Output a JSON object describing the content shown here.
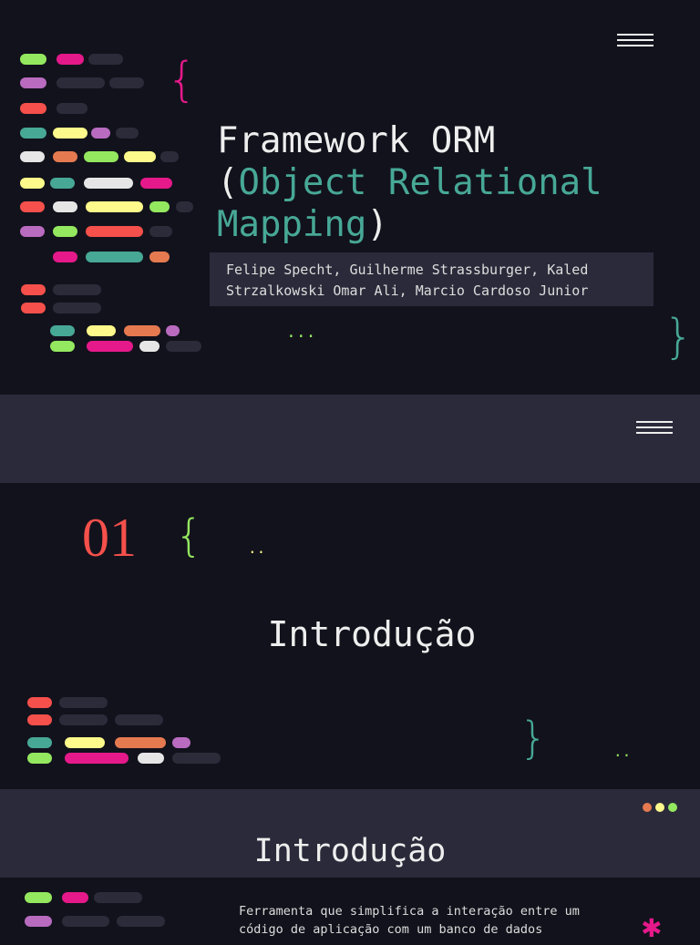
{
  "colors": {
    "bg": "#12121c",
    "panel": "#2b2a3a",
    "green": "#94e85f",
    "pink": "#e5198a",
    "purple": "#b86bbf",
    "red": "#f5504b",
    "teal": "#47a896",
    "yellow": "#fdf98b",
    "white": "#e6e6e6",
    "orange": "#e57a50",
    "dark": "#2c2b3a"
  },
  "slide1": {
    "title_line1": "Framework ORM",
    "paren_open": "(",
    "title_accent1": "Object Relational",
    "title_accent2": "Mapping",
    "paren_close": ")",
    "authors_line1": "Felipe Specht, Guilherme Strassburger, Kaled",
    "authors_line2": "Strzalkowski Omar Ali, Marcio Cardoso Junior",
    "ellipsis": "...",
    "brace_open": "{",
    "brace_close": "}"
  },
  "slide2": {
    "number": "01",
    "brace_open": "{",
    "dots": "..",
    "title": "Introdução",
    "brace_close": "}",
    "dots2": ".."
  },
  "slide3": {
    "title": "Introdução",
    "body_line1": "Ferramenta que simplifica a interação entre um",
    "body_line2": "código de aplicação com um banco de dados"
  }
}
